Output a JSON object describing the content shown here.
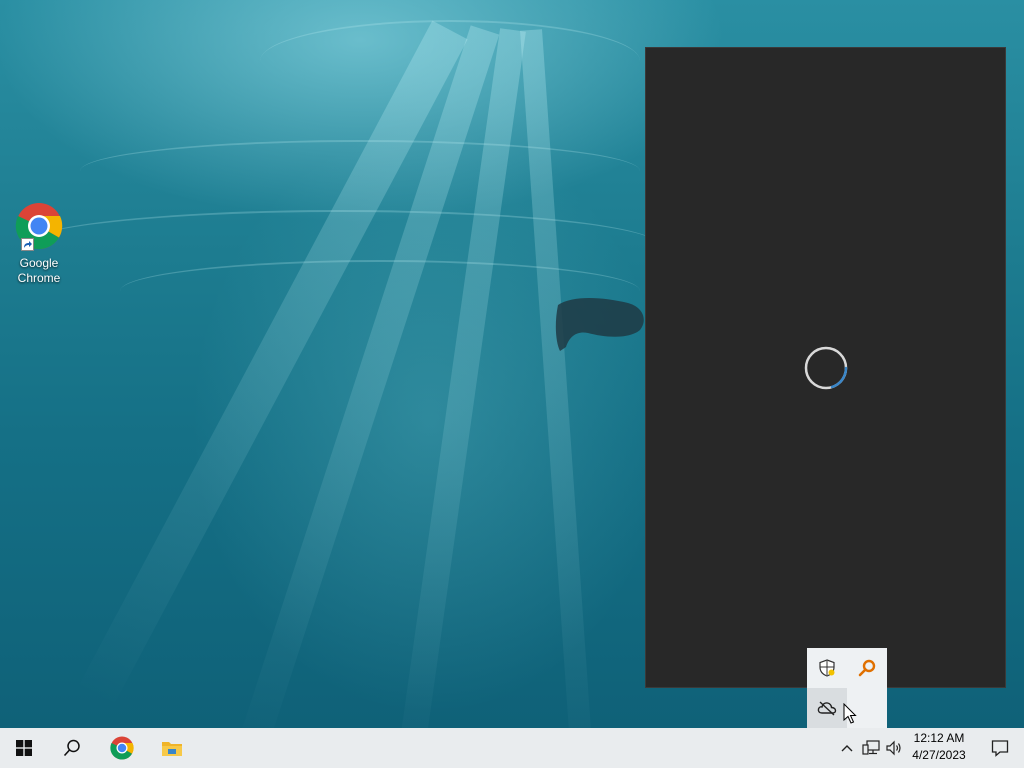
{
  "desktop": {
    "icons": [
      {
        "label": "Google Chrome",
        "icon": "chrome-icon"
      }
    ]
  },
  "flyout": {
    "state": "loading",
    "spinner_icon": "loading-spinner-icon",
    "background": "#282828"
  },
  "tray_overflow": {
    "items": [
      {
        "icon": "windows-security-shield-icon"
      },
      {
        "icon": "orange-search-key-icon"
      },
      {
        "icon": "onedrive-cloud-offline-icon"
      }
    ]
  },
  "taskbar": {
    "start_icon": "windows-start-icon",
    "search_icon": "search-icon",
    "pinned": [
      {
        "icon": "chrome-icon"
      },
      {
        "icon": "file-explorer-icon"
      }
    ],
    "tray": {
      "chevron_icon": "chevron-up-icon",
      "network_icon": "network-icon",
      "volume_icon": "volume-icon",
      "time": "12:12 AM",
      "date": "4/27/2023",
      "notification_icon": "action-center-icon"
    }
  },
  "colors": {
    "taskbar": "#e9ecee",
    "spinner_accent": "#3a86c8"
  }
}
